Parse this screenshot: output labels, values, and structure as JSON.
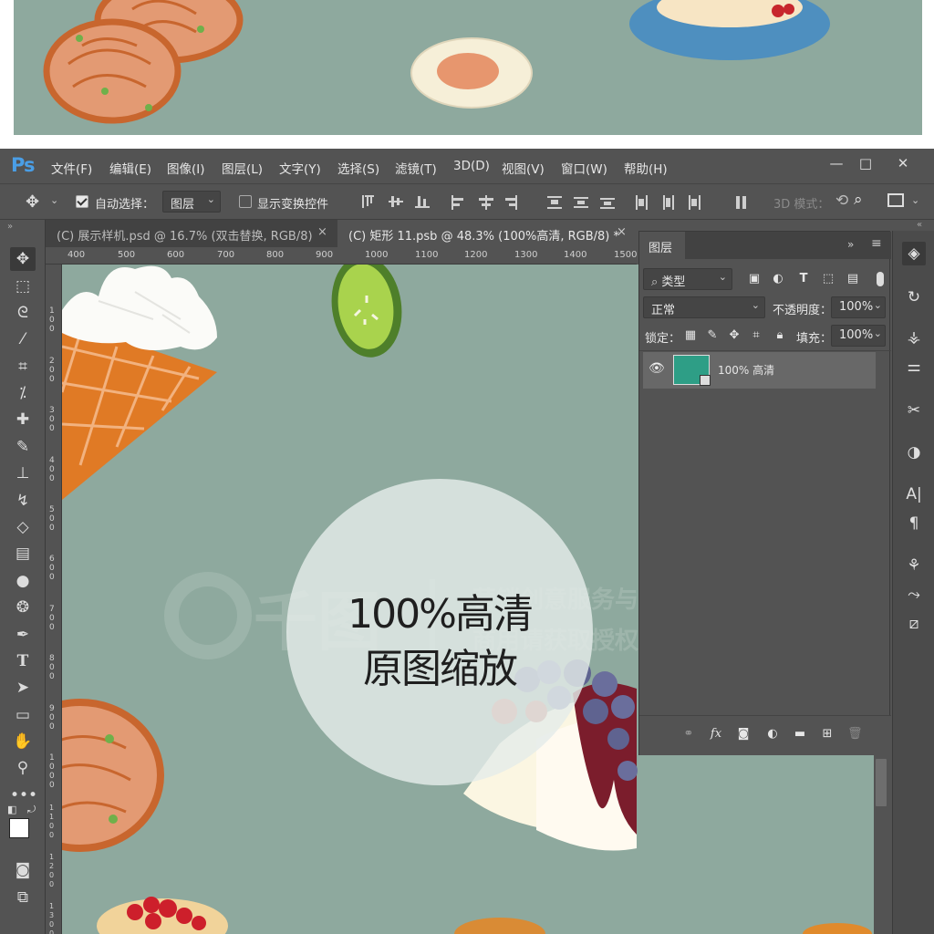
{
  "app": {
    "logo": "Ps",
    "menu": [
      "文件(F)",
      "编辑(E)",
      "图像(I)",
      "图层(L)",
      "文字(Y)",
      "选择(S)",
      "滤镜(T)",
      "3D(D)",
      "视图(V)",
      "窗口(W)",
      "帮助(H)"
    ],
    "window_controls": [
      "—",
      "□",
      "✕"
    ]
  },
  "options": {
    "auto_select_label": "自动选择：",
    "auto_select_value": "图层",
    "show_transform_label": "显示变换控件",
    "mode_3d_label": "3D 模式："
  },
  "tabs": [
    {
      "label": "(C) 展示样机.psd @ 16.7% (双击替换, RGB/8)",
      "close": "×",
      "active": false
    },
    {
      "label": "(C) 矩形 11.psb @ 48.3% (100%高清, RGB/8) *",
      "close": "×",
      "active": true
    }
  ],
  "ruler": {
    "h_ticks": [
      "400",
      "500",
      "600",
      "700",
      "800",
      "900",
      "1000",
      "1100",
      "1200",
      "1300",
      "1400",
      "1500"
    ],
    "v_ticks": [
      "100",
      "200",
      "300",
      "400",
      "500",
      "600",
      "700",
      "800",
      "900",
      "1000",
      "1100",
      "1200",
      "1300"
    ]
  },
  "layers_panel": {
    "title": "图层",
    "filter_value": "类型",
    "blend_mode": "正常",
    "opacity_label": "不透明度：",
    "opacity_value": "100%",
    "lock_label": "锁定：",
    "fill_label": "填充：",
    "fill_value": "100%",
    "layer_name": "100% 高清",
    "thumb_color": "#2e9e86"
  },
  "watermark": {
    "brand": "千图",
    "line1": "营销创意服务与协作平台",
    "line2": "商用请获取授权"
  },
  "overlay": {
    "line1": "100%高清",
    "line2": "原图缩放"
  },
  "colors": {
    "canvas_bg": "#8ea99e",
    "ui_bg": "#535353",
    "ps_blue": "#4a9ee6"
  }
}
